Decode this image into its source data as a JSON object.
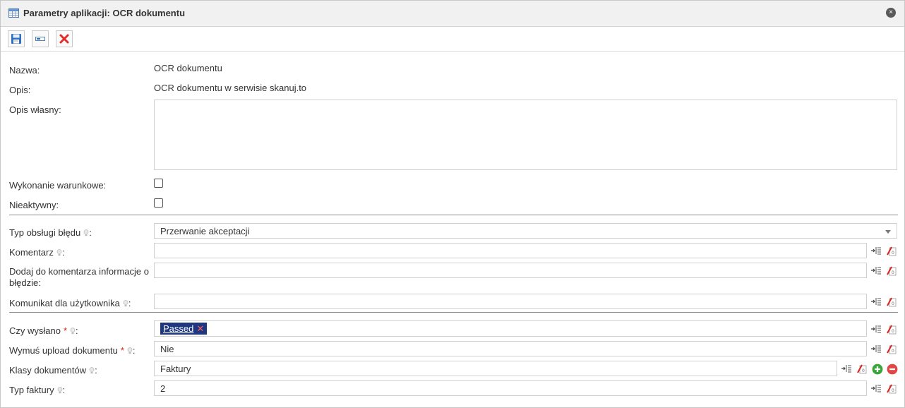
{
  "window": {
    "title": "Parametry aplikacji: OCR dokumentu",
    "close_symbol": "×"
  },
  "toolbar": {
    "buttons": [
      "save-icon",
      "form-icon",
      "delete-icon"
    ]
  },
  "fields": {
    "nazwa": {
      "label": "Nazwa:",
      "value": "OCR dokumentu"
    },
    "opis": {
      "label": "Opis:",
      "value": "OCR dokumentu w serwisie skanuj.to"
    },
    "opis_wlasny": {
      "label": "Opis własny:",
      "value": ""
    },
    "wykonanie_warunkowe": {
      "label": "Wykonanie warunkowe:",
      "checked": false
    },
    "nieaktywny": {
      "label": "Nieaktywny:",
      "checked": false
    },
    "typ_obslugi_bledu": {
      "label": "Typ obsługi błędu",
      "suffix": ":",
      "value": "Przerwanie akceptacji"
    },
    "komentarz": {
      "label": "Komentarz",
      "suffix": ":",
      "value": ""
    },
    "dodaj_do_komentarza": {
      "label_line1": "Dodaj do komentarza informacje o",
      "label_line2": "błędzie:",
      "value": ""
    },
    "komunikat": {
      "label": "Komunikat dla użytkownika",
      "suffix": ":",
      "value": ""
    },
    "czy_wyslano": {
      "label": "Czy wysłano",
      "required": "*",
      "suffix": ":",
      "tag": "Passed",
      "tag_remove": "✕"
    },
    "wymus_upload": {
      "label": "Wymuś upload dokumentu",
      "required": "*",
      "suffix": ":",
      "value": "Nie"
    },
    "klasy_dokumentow": {
      "label": "Klasy dokumentów",
      "suffix": ":",
      "value": "Faktury"
    },
    "typ_faktury": {
      "label": "Typ faktury",
      "suffix": ":",
      "value": "2"
    }
  },
  "colors": {
    "tag_bg": "#1f3780",
    "required": "#d9230f",
    "add_green": "#3aa63a",
    "remove_red": "#e04646"
  }
}
